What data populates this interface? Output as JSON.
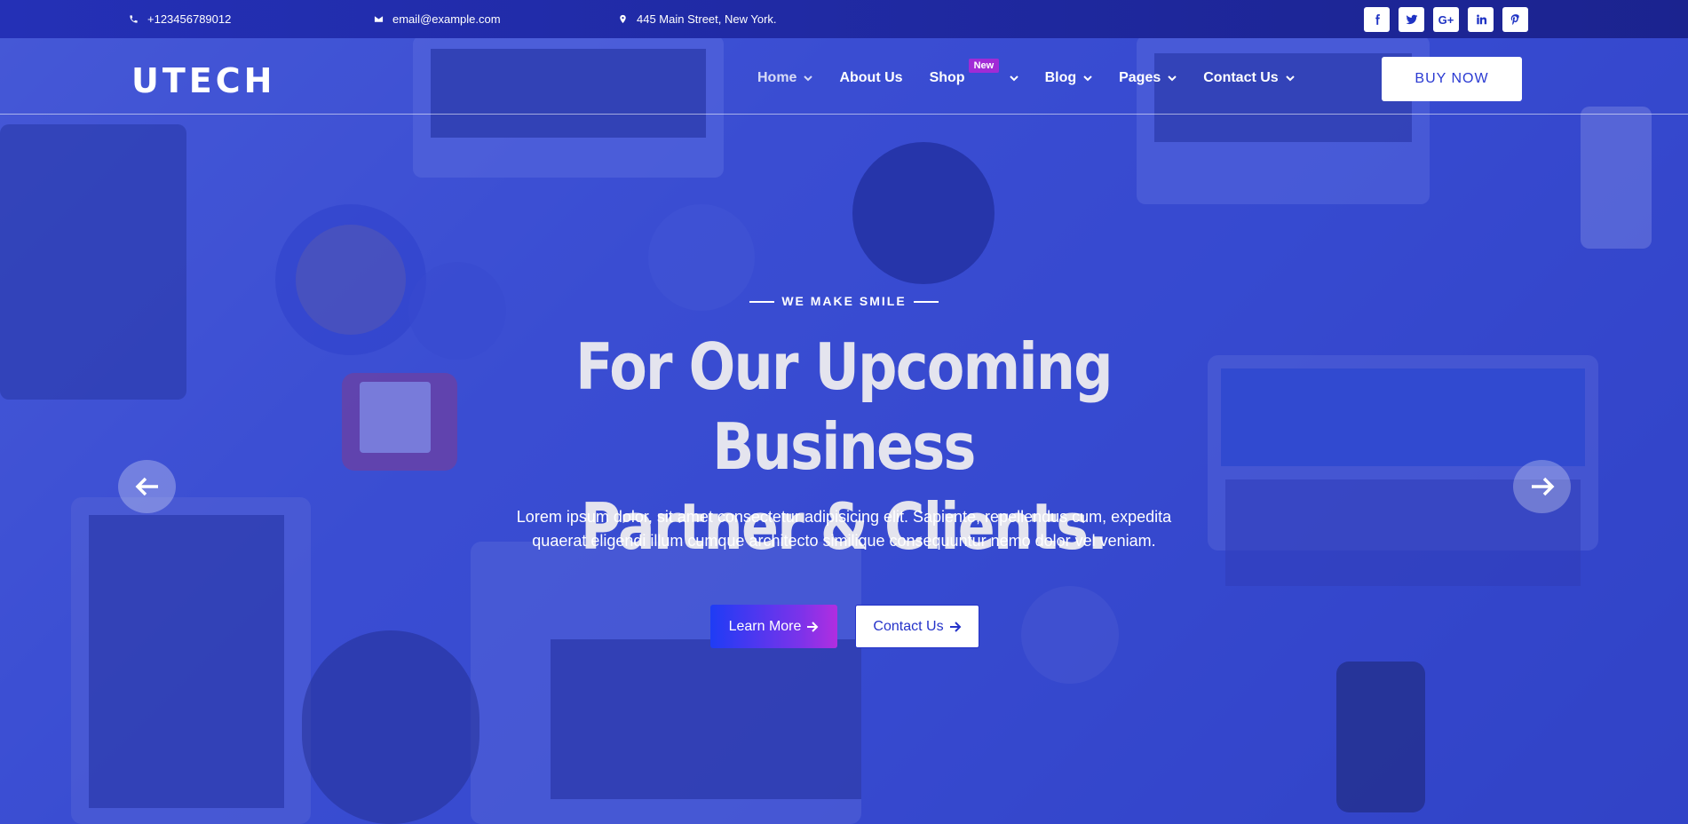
{
  "topbar": {
    "phone": "+123456789012",
    "email": "email@example.com",
    "address": "445 Main Street, New York.",
    "socials": [
      "facebook-icon",
      "twitter-icon",
      "google-plus-icon",
      "linkedin-icon",
      "pinterest-icon"
    ],
    "google_plus_label": "G+"
  },
  "nav": {
    "logo": "UTECH",
    "items": [
      {
        "label": "Home"
      },
      {
        "label": "About Us"
      },
      {
        "label": "Shop",
        "badge": "New"
      },
      {
        "label": "Blog"
      },
      {
        "label": "Pages"
      },
      {
        "label": "Contact Us"
      }
    ],
    "buy_label": "BUY NOW"
  },
  "hero": {
    "eyebrow": "WE MAKE SMILE",
    "headline_line1": "For Our Upcoming Business",
    "headline_line2": "Partner & Clients.",
    "lead": "Lorem ipsum dolor, sit amet consectetur adipisicing elit. Sapiente, repellendus cum, expedita quaerat eligendi illum cumque architecto similique consequuntur nemo dolor vel veniam.",
    "primary_label": "Learn More",
    "secondary_label": "Contact Us"
  },
  "colors": {
    "topbar": "#2430b6",
    "accent": "#2a3ad2",
    "gradient_start": "#1f3cf5",
    "gradient_end": "#b12ee0",
    "badge": "#a12bd6"
  }
}
